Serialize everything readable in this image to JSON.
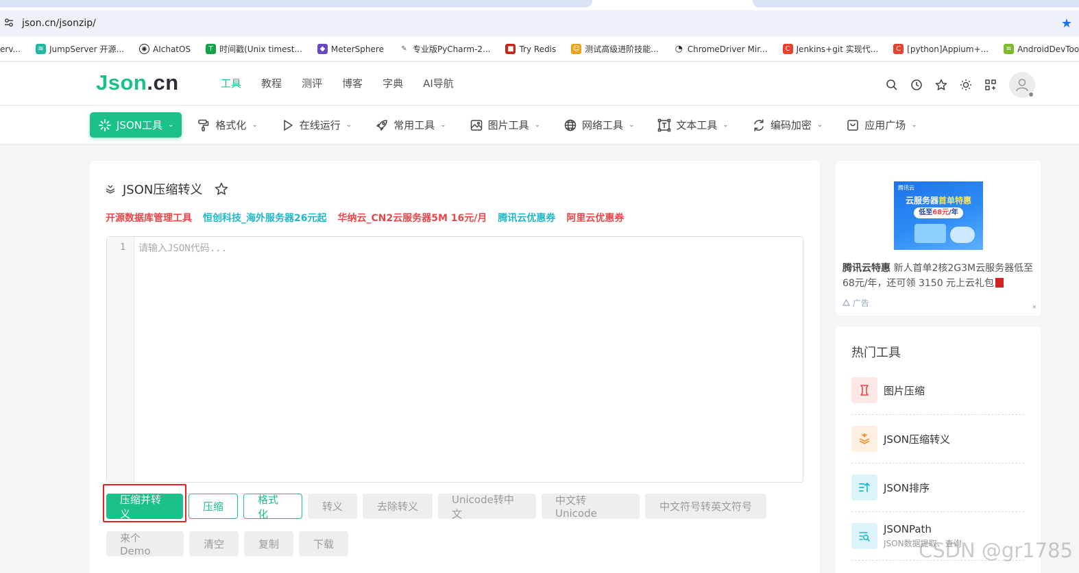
{
  "browser": {
    "url": "json.cn/jsonzip/",
    "bookmarks": [
      {
        "label": "erv...",
        "color": ""
      },
      {
        "label": "JumpServer 开源...",
        "color": "#1fb8a0"
      },
      {
        "label": "AIchatOS",
        "color": "#222222"
      },
      {
        "label": "时间戳(Unix timest...",
        "color": "#14a24a"
      },
      {
        "label": "MeterSphere",
        "color": "#6b46c1"
      },
      {
        "label": "专业版PyCharm-2...",
        "color": "#555555"
      },
      {
        "label": "Try Redis",
        "color": "#c7261d"
      },
      {
        "label": "测试高级进阶技能...",
        "color": "#e8a317"
      },
      {
        "label": "ChromeDriver Mir...",
        "color": "#222222"
      },
      {
        "label": "Jenkins+git 实现代...",
        "color": "#e8412c"
      },
      {
        "label": "[python]Appium+...",
        "color": "#e8412c"
      },
      {
        "label": "AndroidDevTools...",
        "color": "#7cbb2c"
      }
    ]
  },
  "header": {
    "logo_a": "Json",
    "logo_b": ".cn",
    "nav": [
      "工具",
      "教程",
      "测评",
      "博客",
      "字典",
      "AI导航"
    ]
  },
  "subnav": {
    "items": [
      {
        "label": "JSON工具",
        "icon": "sparkle-icon"
      },
      {
        "label": "格式化",
        "icon": "paint-roller-icon"
      },
      {
        "label": "在线运行",
        "icon": "play-icon"
      },
      {
        "label": "常用工具",
        "icon": "rocket-icon"
      },
      {
        "label": "图片工具",
        "icon": "image-icon"
      },
      {
        "label": "网络工具",
        "icon": "globe-icon"
      },
      {
        "label": "文本工具",
        "icon": "text-frame-icon"
      },
      {
        "label": "编码加密",
        "icon": "refresh-code-icon"
      },
      {
        "label": "应用广场",
        "icon": "app-store-icon"
      }
    ]
  },
  "tool": {
    "title": "JSON压缩转义",
    "promos": [
      {
        "text": "开源数据库管理工具",
        "color": "red"
      },
      {
        "text": "恒创科技_海外服务器26元起",
        "color": "cyan"
      },
      {
        "text": "华纳云_CN2云服务器5M 16元/月",
        "color": "red"
      },
      {
        "text": "腾讯云优惠券",
        "color": "cyan"
      },
      {
        "text": "阿里云优惠券",
        "color": "red"
      }
    ],
    "editor": {
      "line_number": "1",
      "placeholder": "请输入JSON代码..."
    },
    "buttons_row1": [
      "压缩并转义",
      "压缩",
      "格式化",
      "转义",
      "去除转义",
      "Unicode转中文",
      "中文转Unicode",
      "中文符号转英文符号"
    ],
    "buttons_row2": [
      "来个Demo",
      "清空",
      "复制",
      "下载"
    ]
  },
  "ad": {
    "brand": "腾讯云",
    "headline_a": "云服务器",
    "headline_b": "首单特惠",
    "price_a": "低至",
    "price_b": "68元",
    "price_c": "/年",
    "title": "腾讯云特惠",
    "text": "新人首单2核2G3M云服务器低至68元/年，还可领 3150 元上云礼包",
    "tag": "广告",
    "close": "×"
  },
  "hot": {
    "title": "热门工具",
    "items": [
      {
        "name": "图片压缩",
        "sub": "",
        "bg": "#fde8e8",
        "fg": "#e8474a"
      },
      {
        "name": "JSON压缩转义",
        "sub": "",
        "bg": "#fdf0e2",
        "fg": "#f0932b"
      },
      {
        "name": "JSON排序",
        "sub": "",
        "bg": "#ddf3fb",
        "fg": "#1fb8c9"
      },
      {
        "name": "JSONPath",
        "sub": "JSON数据提取、查询",
        "bg": "#ddf3fb",
        "fg": "#1fb8c9"
      }
    ]
  },
  "watermark": "CSDN @gr1785"
}
